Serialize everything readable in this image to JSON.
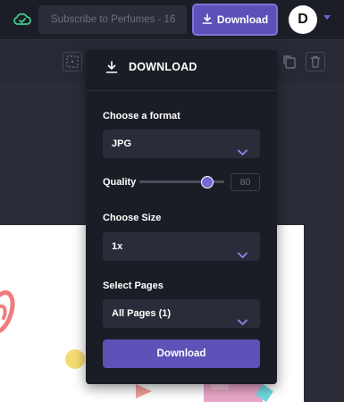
{
  "header": {
    "design_title": "Subscribe to Perfumes - 16",
    "download_label": "Download",
    "avatar_initial": "D"
  },
  "panel": {
    "title": "DOWNLOAD",
    "format_label": "Choose a format",
    "format_value": "JPG",
    "quality_label": "Quality",
    "quality_value": "80",
    "quality_level": 0.8,
    "size_label": "Choose Size",
    "size_value": "1x",
    "pages_label": "Select Pages",
    "pages_value": "All Pages (1)",
    "submit_label": "Download"
  },
  "colors": {
    "accent": "#5b51b8",
    "panel_bg": "#1b1d26",
    "field_bg": "#2a2d39",
    "cloud_status": "#3ecf8e"
  },
  "icons": {
    "status": "cloud-check-icon",
    "download": "download-icon",
    "caret": "caret-down-icon",
    "chevron": "chevron-down-icon"
  }
}
